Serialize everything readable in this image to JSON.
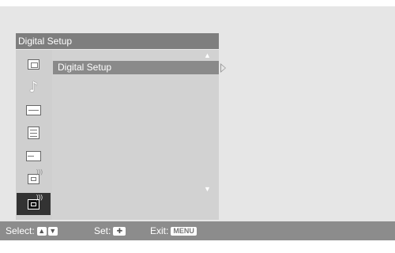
{
  "menu": {
    "title": "Digital Setup",
    "selected_item": "Digital Setup",
    "sidebar_icons": [
      "picture-icon",
      "sound-icon",
      "screen-icon",
      "setup-icon",
      "input-icon",
      "analog-setup-icon",
      "digital-setup-icon"
    ],
    "selected_sidebar_index": 6
  },
  "help": {
    "select_label": "Select:",
    "set_label": "Set:",
    "exit_label": "Exit:",
    "menu_key": "MENU"
  },
  "colors": {
    "title_bar": "#7e7e7e",
    "panel": "#d2d2d2",
    "help_bar": "#8c8c8c",
    "background": "#e6e6e6"
  }
}
